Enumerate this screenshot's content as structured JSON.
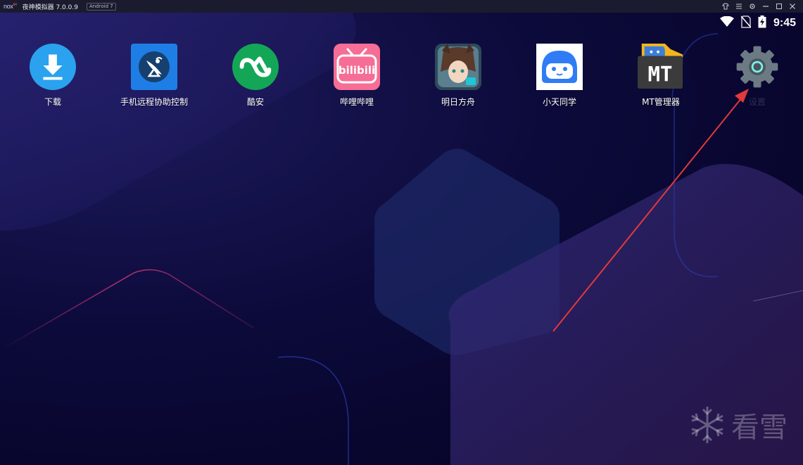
{
  "titlebar": {
    "logo_text": "nox",
    "logo_sup": "64",
    "app_title": "夜神模拟器 7.0.0.9",
    "android_badge": "Android 7"
  },
  "statusbar": {
    "time": "9:45"
  },
  "apps": [
    {
      "label": "下载",
      "icon": "download-icon",
      "color": "#2aa2ee"
    },
    {
      "label": "手机远程协助控制",
      "icon": "satellite-dish-icon",
      "color": "#1e7ee6"
    },
    {
      "label": "酷安",
      "icon": "coolapk-icon",
      "color": "#14a657"
    },
    {
      "label": "哔哩哔哩",
      "icon": "bilibili-icon",
      "color": "#f66d95"
    },
    {
      "label": "明日方舟",
      "icon": "arknights-icon",
      "color": "#2e4a5a"
    },
    {
      "label": "小天同学",
      "icon": "xiaotian-icon",
      "color": "#2f7cf6"
    },
    {
      "label": "MT管理器",
      "icon": "mt-manager-icon",
      "color": "#3b3b3b"
    },
    {
      "label": "设置",
      "icon": "settings-gear-icon",
      "color": "#6c7a84"
    }
  ],
  "icon_texts": {
    "bilibili": "bilibili",
    "mt": "MT"
  },
  "watermark": {
    "text": "看雪"
  },
  "colors": {
    "arrow": "#e2393a",
    "background": "#07052a"
  }
}
